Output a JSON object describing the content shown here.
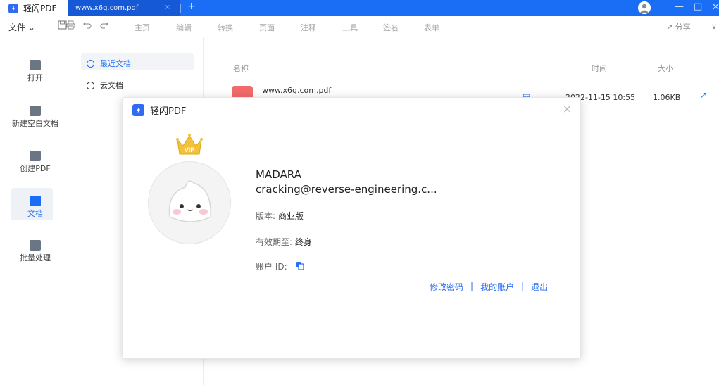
{
  "titlebar": {
    "app_name": "轻闪PDF",
    "doc_tab": "www.x6g.com.pdf",
    "tab_add": "+",
    "close_tab": "×",
    "minimize": "—",
    "maximize": "□",
    "close": "×",
    "brand_color": "#1a6ef5"
  },
  "toolbar": {
    "file_menu": "文件",
    "items": [
      "主页",
      "编辑",
      "转换",
      "页面",
      "注释",
      "工具",
      "签名",
      "表单"
    ],
    "share": "分享",
    "chevron": "∨"
  },
  "leftnav": {
    "items": [
      {
        "label": "打开",
        "icon": "folder-icon"
      },
      {
        "label": "新建空白文档",
        "icon": "new-document-icon"
      },
      {
        "label": "创建PDF",
        "icon": "create-pdf-icon"
      },
      {
        "label": "文档",
        "icon": "documents-icon"
      },
      {
        "label": "批量处理",
        "icon": "batch-icon"
      }
    ],
    "active_index": 3
  },
  "subnav": {
    "items": [
      {
        "label": "最近文档",
        "icon": "clock-icon",
        "active": true
      },
      {
        "label": "云文档",
        "icon": "cloud-icon",
        "active": false
      }
    ]
  },
  "filelist": {
    "columns": {
      "name": "名称",
      "time": "时间",
      "size": "大小"
    },
    "rows": [
      {
        "name": "www.x6g.com.pdf",
        "time": "2022-11-15 10:55",
        "size": "1.06KB"
      }
    ]
  },
  "dialog": {
    "title": "轻闪PDF",
    "close": "×",
    "vip_badge": "VIP",
    "user_name": "MADARA",
    "email": "cracking@reverse-engineering.c...",
    "version_label": "版本:",
    "version_value": "商业版",
    "expiry_label": "有效期至:",
    "expiry_value": "终身",
    "account_id_label": "账户 ID:",
    "links": {
      "change_password": "修改密码",
      "my_account": "我的账户",
      "logout": "退出",
      "separator": "|"
    }
  }
}
